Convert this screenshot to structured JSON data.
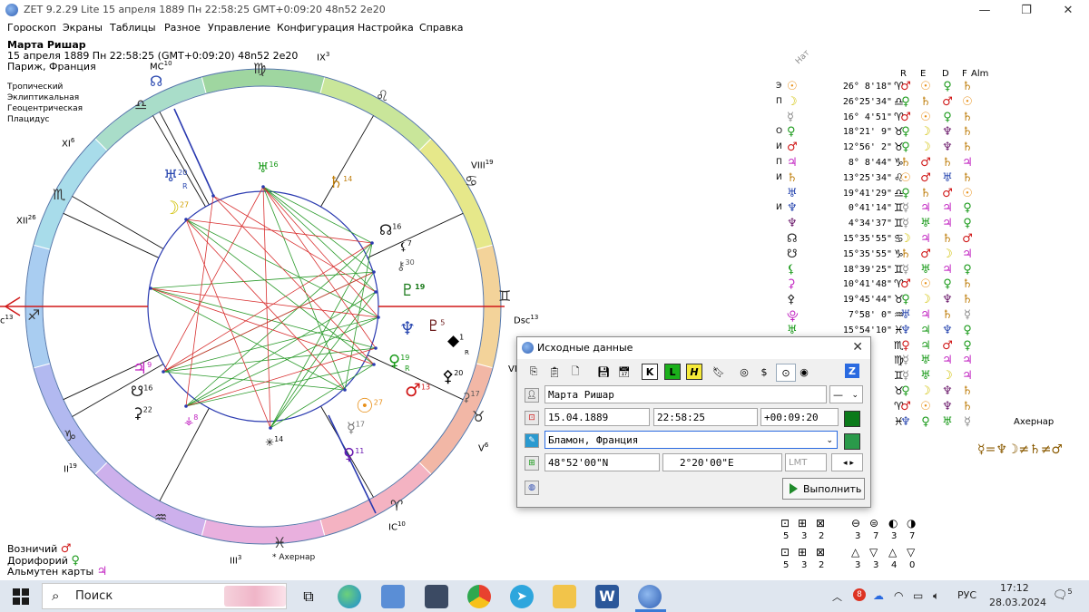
{
  "window": {
    "title": "ZET 9.2.29 Lite    15 апреля 1889  Пн  22:58:25 GMT+0:09:20 48n52  2e20",
    "min": "—",
    "max": "❐",
    "close": "✕"
  },
  "menu": [
    "Гороскоп",
    "Экраны",
    "Таблицы",
    "Разное",
    "Управление",
    "Конфигурация",
    "Настройка",
    "Справка"
  ],
  "header": {
    "name": "Марта Ришар",
    "line2": "15 апреля 1889  Пн   22:58:25 (GMT+0:09:20) 48n52  2e20",
    "place": "Париж, Франция"
  },
  "settings": [
    "Тропический",
    "Эклиптикальная",
    "Геоцентрическая",
    "Плацидус"
  ],
  "houses": {
    "mc": "MC",
    "mc_deg": "10",
    "ix": "IX",
    "ix_deg": "3",
    "xi": "XI",
    "xi_deg": "6",
    "xii": "XII",
    "xii_deg": "26",
    "asc_deg": "13",
    "dsc": "Dsc",
    "dsc_deg": "13",
    "viii": "VIII",
    "viii_deg": "19",
    "vi": "V",
    "vi_deg": "6",
    "ii": "II",
    "ii_deg": "19",
    "iii": "III",
    "iii_deg": "3",
    "ic": "IC",
    "ic_deg": "10",
    "vii": "VI"
  },
  "chart_glyphs": {
    "uranus_deg": "20",
    "moon_deg": "27",
    "neptune_top_deg": "16",
    "saturn_deg": "14",
    "node_deg": "16",
    "lilith_deg": "7",
    "chiron_deg": "30",
    "jupiter_r_deg": "19",
    "neptune_deg": "5",
    "pluto_deg": "5",
    "black_deg": "1",
    "venus_deg": "19",
    "mars_deg": "13",
    "tri_deg": "20",
    "axe_deg": "17",
    "sun_deg": "27",
    "mercury_deg": "17",
    "venus2_deg": "11",
    "star_deg": "14",
    "jup_left_deg": "9",
    "node_left_deg": "16",
    "venus_left_deg": "22",
    "small_deg": "8",
    "retro": "R",
    "acher": "Ахернар"
  },
  "bottom_left": {
    "voz": "Возничий",
    "dor": "Дорифорий",
    "alm": "Альмутен карты"
  },
  "table": {
    "header": {
      "nat": "Нат",
      "r": "R",
      "e": "E",
      "d": "D",
      "f": "F",
      "alm": "Alm"
    },
    "rows": [
      {
        "i": "Э",
        "p": "☉",
        "pc": "#e8901a",
        "d": "26° 8'18\"",
        "s": "♈",
        "c": [
          "♂",
          "☉",
          "♀",
          "♄"
        ],
        "cc": [
          "#d01818",
          "#e8901a",
          "#1a9a1a",
          "#c08010"
        ]
      },
      {
        "i": "П",
        "p": "☽",
        "pc": "#d0c000",
        "d": "26°25'34\"",
        "s": "♎",
        "c": [
          "♀",
          "♄",
          "♂",
          "☉"
        ],
        "cc": [
          "#1a9a1a",
          "#c08010",
          "#d01818",
          "#e8901a"
        ]
      },
      {
        "i": "",
        "p": "☿",
        "pc": "#888",
        "d": "16° 4'51\"",
        "s": "♈",
        "c": [
          "♂",
          "☉",
          "♀",
          "♄"
        ],
        "cc": [
          "#d01818",
          "#e8901a",
          "#1a9a1a",
          "#c08010"
        ]
      },
      {
        "i": "О",
        "p": "♀",
        "pc": "#1a9a1a",
        "d": "18°21' 9\"",
        "s": "♉",
        "c": [
          "♀",
          "☽",
          "♆",
          "♄"
        ],
        "cc": [
          "#1a9a1a",
          "#d0c000",
          "#6b1a6b",
          "#c08010"
        ]
      },
      {
        "i": "И",
        "p": "♂",
        "pc": "#d01818",
        "d": "12°56' 2\"",
        "s": "♉",
        "c": [
          "♀",
          "☽",
          "♆",
          "♄"
        ],
        "cc": [
          "#1a9a1a",
          "#d0c000",
          "#6b1a6b",
          "#c08010"
        ]
      },
      {
        "i": "П",
        "p": "♃",
        "pc": "#c020c0",
        "d": "8° 8'44\"",
        "s": "♑",
        "c": [
          "♄",
          "♂",
          "♄",
          "♃"
        ],
        "cc": [
          "#c08010",
          "#d01818",
          "#c08010",
          "#c020c0"
        ]
      },
      {
        "i": "И",
        "p": "♄",
        "pc": "#c08010",
        "d": "13°25'34\"",
        "s": "♌",
        "c": [
          "☉",
          "♂",
          "♅",
          "♄"
        ],
        "cc": [
          "#e8901a",
          "#d01818",
          "#2a48b0",
          "#c08010"
        ]
      },
      {
        "i": "",
        "p": "♅",
        "pc": "#2a48b0",
        "d": "19°41'29\"",
        "s": "♎",
        "c": [
          "♀",
          "♄",
          "♂",
          "☉"
        ],
        "cc": [
          "#1a9a1a",
          "#c08010",
          "#d01818",
          "#e8901a"
        ]
      },
      {
        "i": "И",
        "p": "♆",
        "pc": "#2a48b0",
        "d": "0°41'14\"",
        "s": "♊",
        "c": [
          "☿",
          "♃",
          "♃",
          "♀"
        ],
        "cc": [
          "#888",
          "#c020c0",
          "#c020c0",
          "#1a9a1a"
        ]
      },
      {
        "i": "",
        "p": "♆",
        "pc": "#6b1a6b",
        "d": "4°34'37\"",
        "s": "♊",
        "c": [
          "☿",
          "♅",
          "♃",
          "♀"
        ],
        "cc": [
          "#888",
          "#1a9a1a",
          "#c020c0",
          "#1a9a1a"
        ]
      },
      {
        "i": "",
        "p": "☊",
        "pc": "#222",
        "d": "15°35'55\"",
        "s": "♋",
        "c": [
          "☽",
          "♃",
          "♄",
          "♂"
        ],
        "cc": [
          "#d0c000",
          "#c020c0",
          "#c08010",
          "#d01818"
        ]
      },
      {
        "i": "",
        "p": "☋",
        "pc": "#222",
        "d": "15°35'55\"",
        "s": "♑",
        "c": [
          "♄",
          "♂",
          "☽",
          "♃"
        ],
        "cc": [
          "#c08010",
          "#d01818",
          "#d0c000",
          "#c020c0"
        ]
      },
      {
        "i": "",
        "p": "⚸",
        "pc": "#1a9a1a",
        "d": "18°39'25\"",
        "s": "♊",
        "c": [
          "☿",
          "♅",
          "♃",
          "♀"
        ],
        "cc": [
          "#888",
          "#1a9a1a",
          "#c020c0",
          "#1a9a1a"
        ]
      },
      {
        "i": "",
        "p": "⚳",
        "pc": "#c020c0",
        "d": "10°41'48\"",
        "s": "♈",
        "c": [
          "♂",
          "☉",
          "♀",
          "♄"
        ],
        "cc": [
          "#d01818",
          "#e8901a",
          "#1a9a1a",
          "#c08010"
        ]
      },
      {
        "i": "",
        "p": "⚴",
        "pc": "#222",
        "d": "19°45'44\"",
        "s": "♉",
        "c": [
          "♀",
          "☽",
          "♆",
          "♄"
        ],
        "cc": [
          "#1a9a1a",
          "#d0c000",
          "#6b1a6b",
          "#c08010"
        ]
      },
      {
        "i": "",
        "p": "⯓",
        "pc": "#c020c0",
        "d": "7°58' 0\"",
        "s": "♒",
        "c": [
          "♅",
          "♃",
          "♄",
          "☿"
        ],
        "cc": [
          "#2a48b0",
          "#c020c0",
          "#c08010",
          "#888"
        ]
      },
      {
        "i": "",
        "p": "♅",
        "pc": "#1a9a1a",
        "d": "15°54'10\"",
        "s": "♓",
        "c": [
          "♆",
          "♃",
          "♆",
          "♀"
        ],
        "cc": [
          "#2a48b0",
          "#1a9a1a",
          "#2a48b0",
          "#1a9a1a"
        ]
      },
      {
        "i": "",
        "p": "",
        "pc": "#222",
        "d": "",
        "s": "♏",
        "c": [
          "♀",
          "♃",
          "♂",
          "♀"
        ],
        "cc": [
          "#d01818",
          "#1a9a1a",
          "#d01818",
          "#1a9a1a"
        ]
      },
      {
        "i": "",
        "p": "",
        "pc": "#222",
        "d": "",
        "s": "♍",
        "c": [
          "☿",
          "♅",
          "♃",
          "♃"
        ],
        "cc": [
          "#888",
          "#1a9a1a",
          "#c020c0",
          "#c020c0"
        ]
      },
      {
        "i": "",
        "p": "",
        "pc": "#222",
        "d": "",
        "s": "♊",
        "c": [
          "☿",
          "♅",
          "☽",
          "♃"
        ],
        "cc": [
          "#888",
          "#1a9a1a",
          "#d0c000",
          "#c020c0"
        ]
      },
      {
        "i": "",
        "p": "",
        "pc": "#222",
        "d": "",
        "s": "♉",
        "c": [
          "♀",
          "☽",
          "♆",
          "♄"
        ],
        "cc": [
          "#1a9a1a",
          "#d0c000",
          "#6b1a6b",
          "#c08010"
        ]
      },
      {
        "i": "",
        "p": "",
        "pc": "#222",
        "d": "",
        "s": "♈",
        "c": [
          "♂",
          "☉",
          "♆",
          "♄"
        ],
        "cc": [
          "#d01818",
          "#e8901a",
          "#6b1a6b",
          "#c08010"
        ]
      },
      {
        "i": "",
        "p": "",
        "pc": "#222",
        "d": "",
        "s": "♓",
        "c": [
          "♆",
          "♀",
          "♅",
          "☿"
        ],
        "cc": [
          "#2a48b0",
          "#1a9a1a",
          "#1a9a1a",
          "#888"
        ]
      }
    ],
    "achernar": "Ахернар",
    "formula": "☿=♆☽≠♄≠♂"
  },
  "dialog": {
    "title": "Исходные данные",
    "close": "✕",
    "name_value": "Марта Ришар",
    "gender_value": "—",
    "date_value": "15.04.1889",
    "time_value": "22:58:25",
    "tz_value": "+00:09:20",
    "place_value": "Бламон, Франция",
    "lat_value": "48°52'00\"N",
    "lon_value": "2°20'00\"E",
    "lmt_value": "LMT",
    "run_label": "Выполнить",
    "z_label": "Z"
  },
  "aspect_counts": {
    "row1": [
      "5",
      "3",
      "2",
      "3",
      "7",
      "3",
      "7"
    ],
    "row2": [
      "5",
      "3",
      "2",
      "3",
      "3",
      "4",
      "0"
    ]
  },
  "taskbar": {
    "search": "Поиск",
    "lang": "РУС",
    "time": "17:12",
    "date": "28.03.2024",
    "notif": "5"
  }
}
